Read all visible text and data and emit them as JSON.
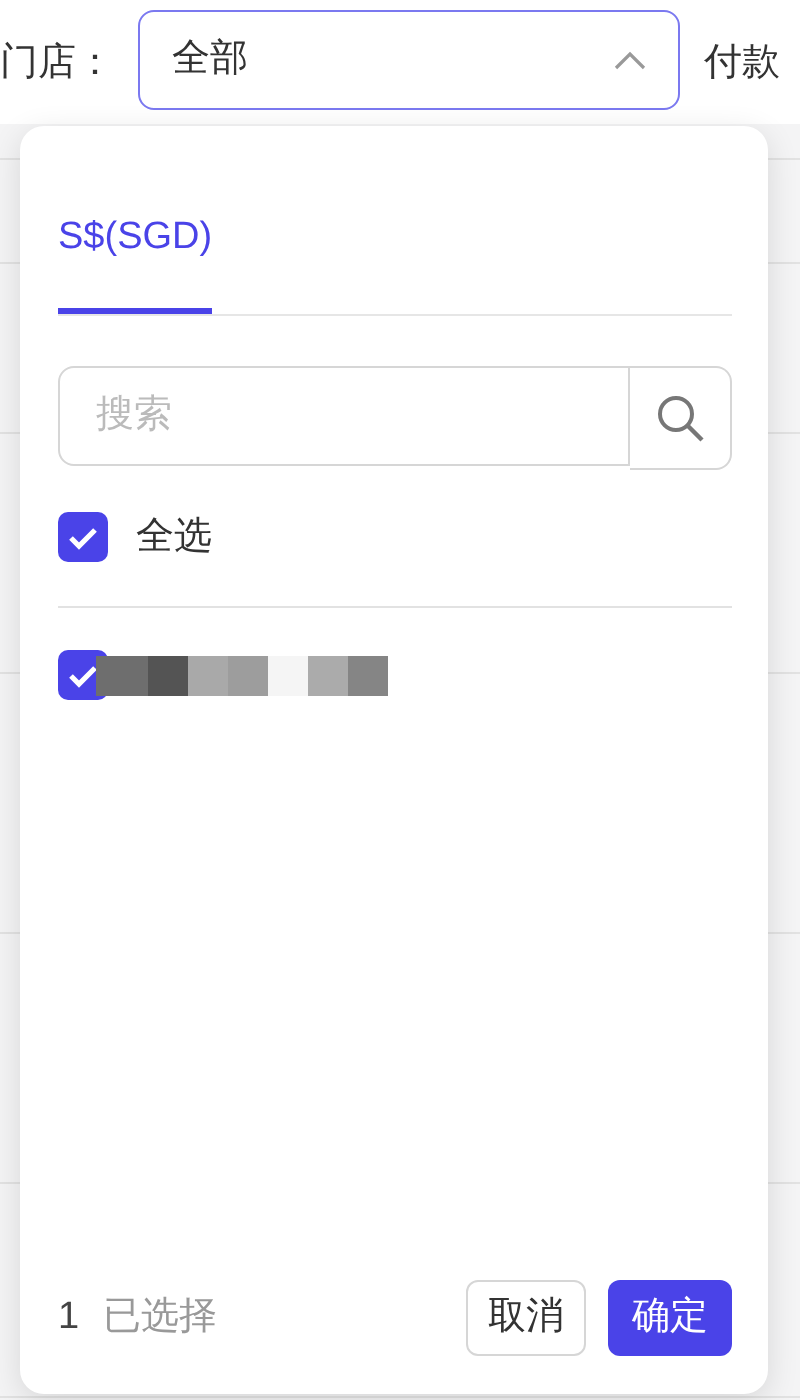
{
  "filter_bar": {
    "store_label": "门店：",
    "store_select": {
      "value": "全部",
      "expanded": true
    },
    "payment_label": "付款"
  },
  "dropdown": {
    "tabs": [
      {
        "label": "S$(SGD)",
        "selected": true
      }
    ],
    "search": {
      "placeholder": "搜索"
    },
    "select_all": {
      "label": "全选",
      "checked": true
    },
    "options": [
      {
        "kind": "redacted",
        "checked": true
      }
    ],
    "footer": {
      "count": "1",
      "count_label": "已选择",
      "buttons": [
        "取消",
        "确定"
      ]
    }
  }
}
